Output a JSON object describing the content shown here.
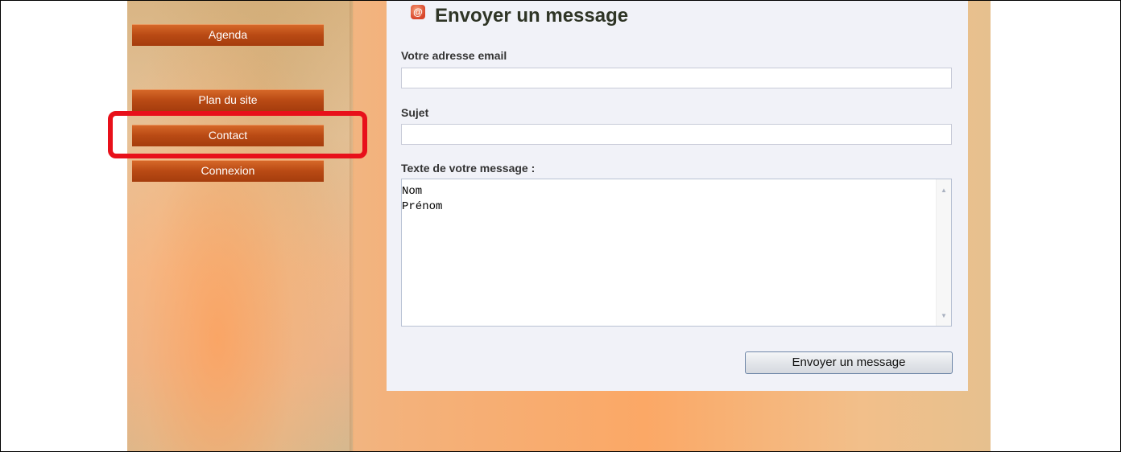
{
  "sidebar": {
    "items": [
      {
        "label": "Agenda"
      },
      {
        "label": "Plan du site"
      },
      {
        "label": "Contact"
      },
      {
        "label": "Connexion"
      }
    ]
  },
  "form": {
    "icon": "email-icon",
    "icon_glyph": "@",
    "title": "Envoyer un message",
    "email_label": "Votre adresse email",
    "email_value": "",
    "subject_label": "Sujet",
    "subject_value": "",
    "message_label": "Texte de votre message :",
    "message_value": "Nom\nPrénom",
    "submit_label": "Envoyer un message"
  },
  "colors": {
    "highlight": "#e8101a",
    "nav_button": "#b94a14"
  }
}
